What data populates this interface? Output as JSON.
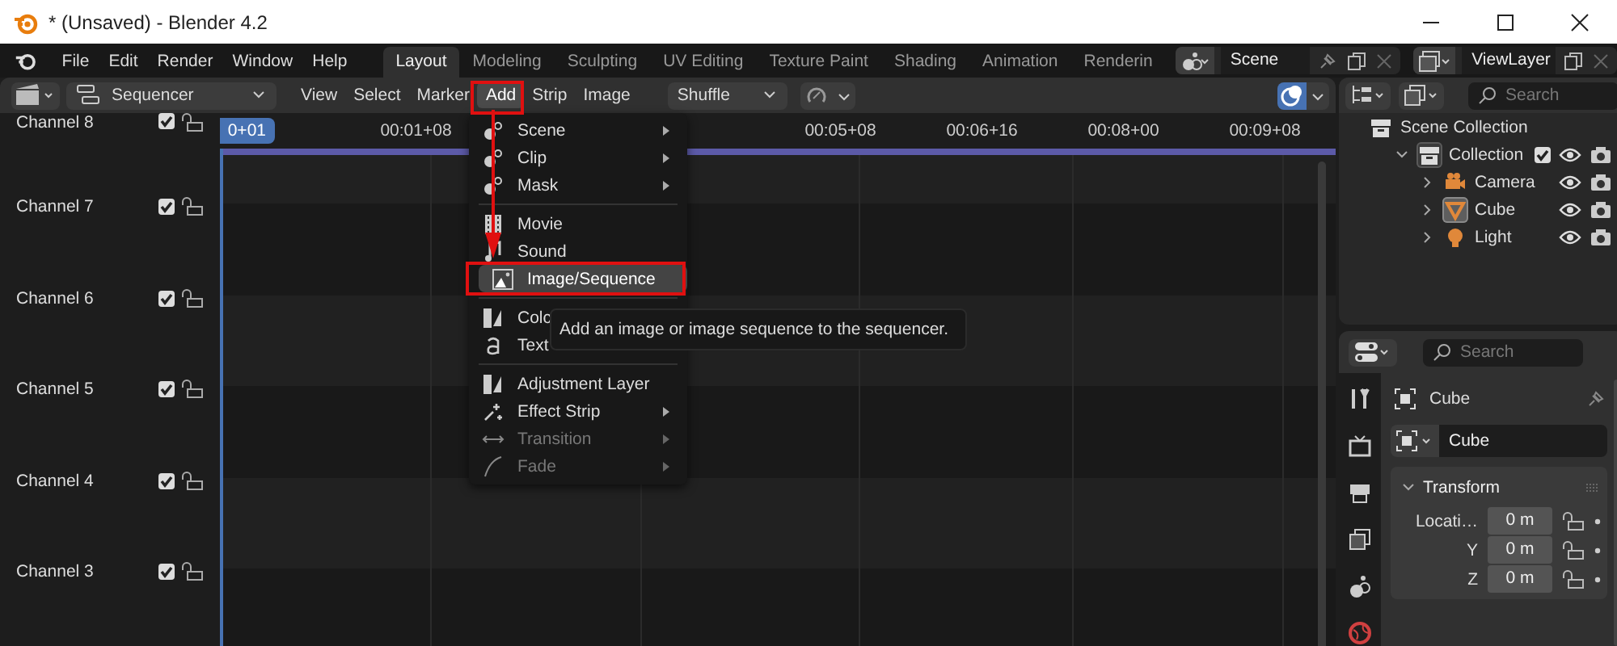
{
  "window": {
    "title": "* (Unsaved) - Blender 4.2"
  },
  "menubar": [
    "File",
    "Edit",
    "Render",
    "Window",
    "Help"
  ],
  "workspaces": [
    {
      "label": "Layout",
      "selected": true
    },
    {
      "label": "Modeling",
      "selected": false
    },
    {
      "label": "Sculpting",
      "selected": false
    },
    {
      "label": "UV Editing",
      "selected": false
    },
    {
      "label": "Texture Paint",
      "selected": false
    },
    {
      "label": "Shading",
      "selected": false
    },
    {
      "label": "Animation",
      "selected": false
    },
    {
      "label": "Renderin",
      "selected": false
    }
  ],
  "scene": {
    "name": "Scene"
  },
  "view_layer": {
    "name": "ViewLayer"
  },
  "sequencer": {
    "editor": "Sequencer",
    "menus": [
      {
        "label": "View",
        "selected": false
      },
      {
        "label": "Select",
        "selected": false
      },
      {
        "label": "Marker",
        "selected": false
      },
      {
        "label": "Add",
        "selected": true
      },
      {
        "label": "Strip",
        "selected": false
      },
      {
        "label": "Image",
        "selected": false
      }
    ],
    "overlap_mode": "Shuffle",
    "snapping_on": false,
    "overlays_on": true,
    "current_frame": "0+01",
    "ruler_labels": [
      "00:01+08",
      "00:05+08",
      "00:06+16",
      "00:08+00",
      "00:09+08"
    ],
    "channels": [
      {
        "name": "Channel 8",
        "visible": true,
        "locked": false
      },
      {
        "name": "Channel 7",
        "visible": true,
        "locked": false
      },
      {
        "name": "Channel 6",
        "visible": true,
        "locked": false
      },
      {
        "name": "Channel 5",
        "visible": true,
        "locked": false
      },
      {
        "name": "Channel 4",
        "visible": true,
        "locked": false
      },
      {
        "name": "Channel 3",
        "visible": true,
        "locked": false
      }
    ]
  },
  "add_menu": {
    "sections": [
      [
        {
          "label": "Scene",
          "submenu": true,
          "disabled": false,
          "selected": false
        },
        {
          "label": "Clip",
          "submenu": true,
          "disabled": false,
          "selected": false
        },
        {
          "label": "Mask",
          "submenu": true,
          "disabled": false,
          "selected": false
        }
      ],
      [
        {
          "label": "Movie",
          "submenu": false,
          "disabled": false,
          "selected": false
        },
        {
          "label": "Sound",
          "submenu": false,
          "disabled": false,
          "selected": false
        },
        {
          "label": "Image/Sequence",
          "submenu": false,
          "disabled": false,
          "selected": true
        }
      ],
      [
        {
          "label": "Colc",
          "disabled": false,
          "selected": false
        },
        {
          "label": "Text",
          "disabled": false,
          "selected": false
        }
      ],
      [
        {
          "label": "Adjustment Layer",
          "submenu": false,
          "disabled": false,
          "selected": false
        },
        {
          "label": "Effect Strip",
          "submenu": true,
          "disabled": false,
          "selected": false
        },
        {
          "label": "Transition",
          "submenu": true,
          "disabled": true,
          "selected": false
        },
        {
          "label": "Fade",
          "submenu": true,
          "disabled": true,
          "selected": false
        }
      ]
    ],
    "tooltip": "Add an image or image sequence to the sequencer."
  },
  "outliner": {
    "search": {
      "placeholder": "Search"
    },
    "tree": [
      {
        "label": "Scene Collection",
        "kind": "scene",
        "children": [
          {
            "label": "Collection",
            "kind": "collection",
            "expanded": true,
            "enabled": true,
            "visible": true,
            "selected": false,
            "children": [
              {
                "label": "Camera",
                "kind": "camera",
                "expanded": false,
                "visible": true,
                "selected": false
              },
              {
                "label": "Cube",
                "kind": "mesh",
                "expanded": false,
                "visible": true,
                "selected": true
              },
              {
                "label": "Light",
                "kind": "light",
                "expanded": false,
                "visible": true,
                "selected": false
              }
            ]
          }
        ]
      }
    ]
  },
  "properties": {
    "search": {
      "placeholder": "Search"
    },
    "context": "Cube",
    "object_name": "Cube",
    "panel": {
      "title": "Transform",
      "expanded": true,
      "rows": [
        {
          "label": "Locati…",
          "value": "0 m"
        },
        {
          "label": "Y",
          "value": "0 m"
        },
        {
          "label": "Z",
          "value": "0 m"
        }
      ]
    }
  }
}
